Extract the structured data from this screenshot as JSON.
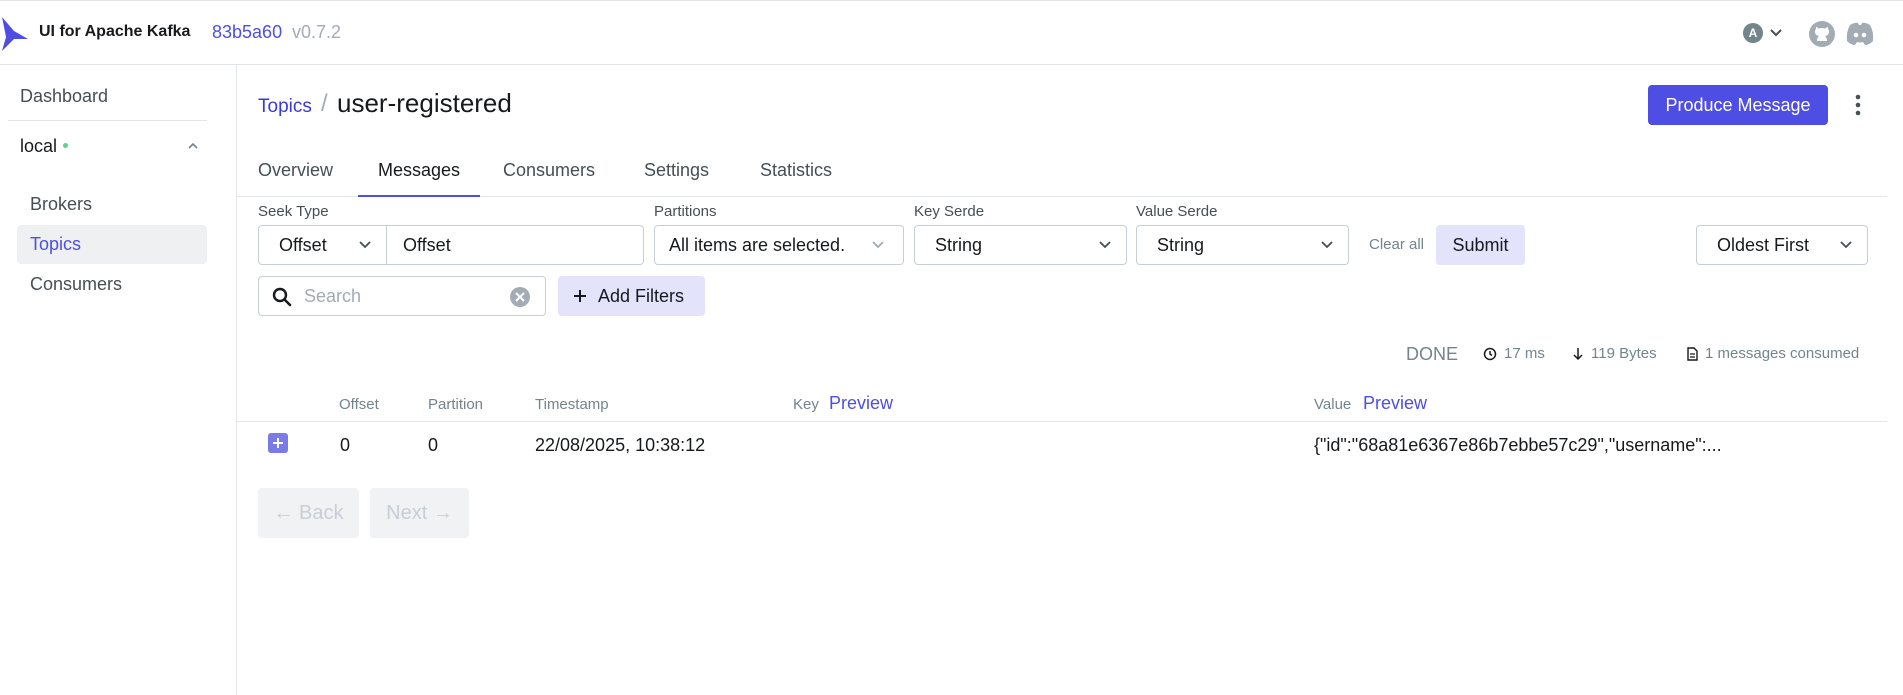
{
  "header": {
    "app_title": "UI for Apache Kafka",
    "version_hash": "83b5a60",
    "version_tag": "v0.7.2",
    "avatar_letter": "A"
  },
  "sidebar": {
    "dashboard": "Dashboard",
    "cluster": "local",
    "items": [
      "Brokers",
      "Topics",
      "Consumers"
    ],
    "active_item": "Topics"
  },
  "breadcrumb": {
    "parent": "Topics",
    "separator": "/",
    "title": "user-registered"
  },
  "actions": {
    "produce": "Produce Message"
  },
  "tabs": [
    "Overview",
    "Messages",
    "Consumers",
    "Settings",
    "Statistics"
  ],
  "active_tab": "Messages",
  "filters": {
    "seek_type_label": "Seek Type",
    "seek_type_value": "Offset",
    "offset_value": "Offset",
    "partitions_label": "Partitions",
    "partitions_value": "All items are selected.",
    "key_serde_label": "Key Serde",
    "key_serde_value": "String",
    "value_serde_label": "Value Serde",
    "value_serde_value": "String",
    "clear_all": "Clear all",
    "submit": "Submit",
    "sort_value": "Oldest First",
    "search_placeholder": "Search",
    "add_filters": "Add Filters"
  },
  "stats": {
    "status": "DONE",
    "elapsed": "17 ms",
    "bytes": "119 Bytes",
    "consumed": "1 messages consumed"
  },
  "table": {
    "headers": {
      "offset": "Offset",
      "partition": "Partition",
      "timestamp": "Timestamp",
      "key": "Key",
      "value": "Value",
      "preview": "Preview"
    },
    "rows": [
      {
        "offset": "0",
        "partition": "0",
        "timestamp": "22/08/2025, 10:38:12",
        "key": "",
        "value": "{\"id\":\"68a81e6367e86b7ebbe57c29\",\"username\":..."
      }
    ]
  },
  "pagination": {
    "back": "← Back",
    "next": "Next →"
  },
  "colors": {
    "accent": "#4f4ee4",
    "accent_light": "#e3e3fc",
    "online": "#5cd685"
  }
}
